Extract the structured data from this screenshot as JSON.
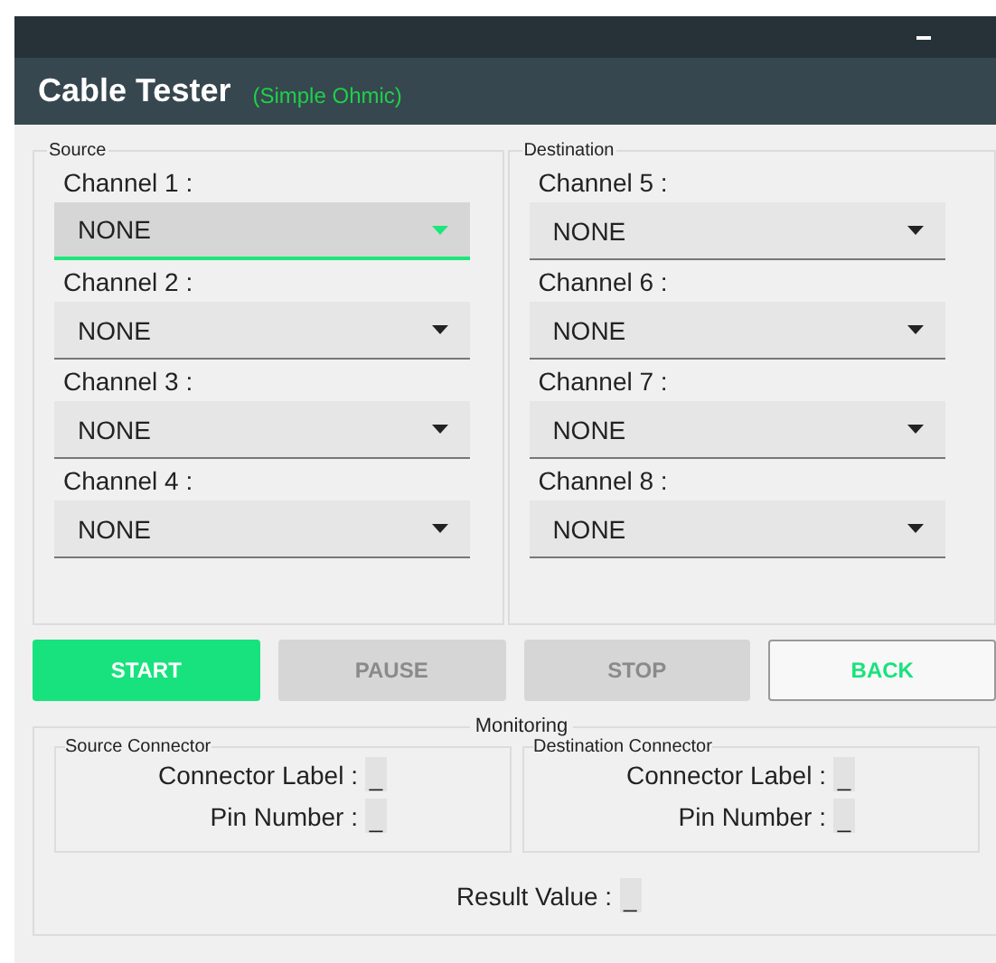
{
  "window": {
    "title": "Cable Tester",
    "subtitle": "(Simple Ohmic)"
  },
  "groups": [
    {
      "title": "Source",
      "channels": [
        {
          "label": "Channel 1 :",
          "value": "NONE",
          "focused": true
        },
        {
          "label": "Channel 2 :",
          "value": "NONE",
          "focused": false
        },
        {
          "label": "Channel 3 :",
          "value": "NONE",
          "focused": false
        },
        {
          "label": "Channel 4 :",
          "value": "NONE",
          "focused": false
        }
      ]
    },
    {
      "title": "Destination",
      "channels": [
        {
          "label": "Channel 5 :",
          "value": "NONE",
          "focused": false
        },
        {
          "label": "Channel 6 :",
          "value": "NONE",
          "focused": false
        },
        {
          "label": "Channel 7 :",
          "value": "NONE",
          "focused": false
        },
        {
          "label": "Channel 8 :",
          "value": "NONE",
          "focused": false
        }
      ]
    }
  ],
  "buttons": [
    {
      "label": "START",
      "kind": "primary",
      "disabled": false
    },
    {
      "label": "PAUSE",
      "kind": "flat",
      "disabled": true
    },
    {
      "label": "STOP",
      "kind": "flat",
      "disabled": true
    },
    {
      "label": "BACK",
      "kind": "outline",
      "disabled": false
    }
  ],
  "monitoring": {
    "title": "Monitoring",
    "connectors": [
      {
        "title": "Source Connector",
        "fields": [
          {
            "label": "Connector Label :",
            "value": "_"
          },
          {
            "label": "Pin Number :",
            "value": "_"
          }
        ]
      },
      {
        "title": "Destination Connector",
        "fields": [
          {
            "label": "Connector Label :",
            "value": "_"
          },
          {
            "label": "Pin Number :",
            "value": "_"
          }
        ]
      }
    ],
    "result": {
      "label": "Result Value :",
      "value": "_"
    }
  }
}
